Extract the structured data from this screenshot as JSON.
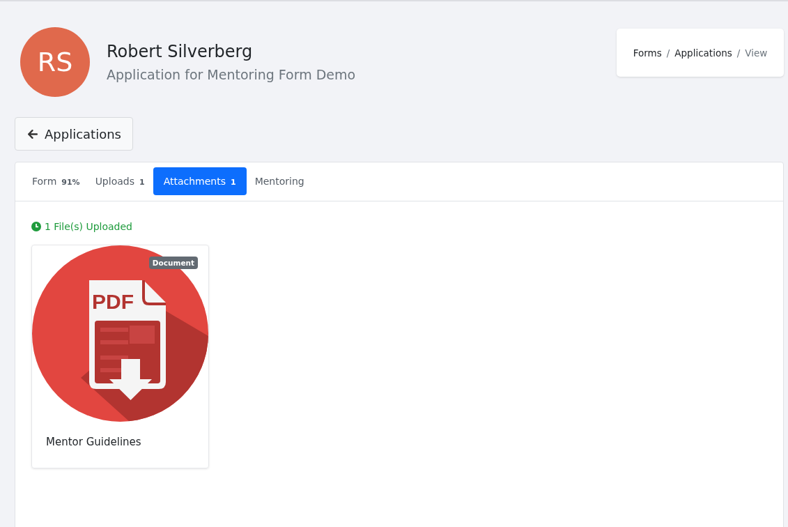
{
  "header": {
    "avatar_initials": "RS",
    "name": "Robert Silverberg",
    "subtitle": "Application for Mentoring Form Demo"
  },
  "breadcrumb": [
    {
      "label": "Forms",
      "current": false
    },
    {
      "separator": "/",
      "label": "Applications",
      "current": false
    },
    {
      "separator": "/",
      "label": "View",
      "current": true
    }
  ],
  "back_button": {
    "label": "Applications"
  },
  "tabs": [
    {
      "label": "Form",
      "badge": "91%",
      "selected": false
    },
    {
      "label": "Uploads",
      "badge": "1",
      "selected": false
    },
    {
      "label": "Attachments",
      "badge": "1",
      "selected": true
    },
    {
      "label": "Mentoring",
      "selected": false
    }
  ],
  "status": "1 File(s) Uploaded",
  "files": [
    {
      "thumbnail_label": "PDF",
      "type_badge": "Document",
      "name": "Mentor Guidelines"
    }
  ]
}
